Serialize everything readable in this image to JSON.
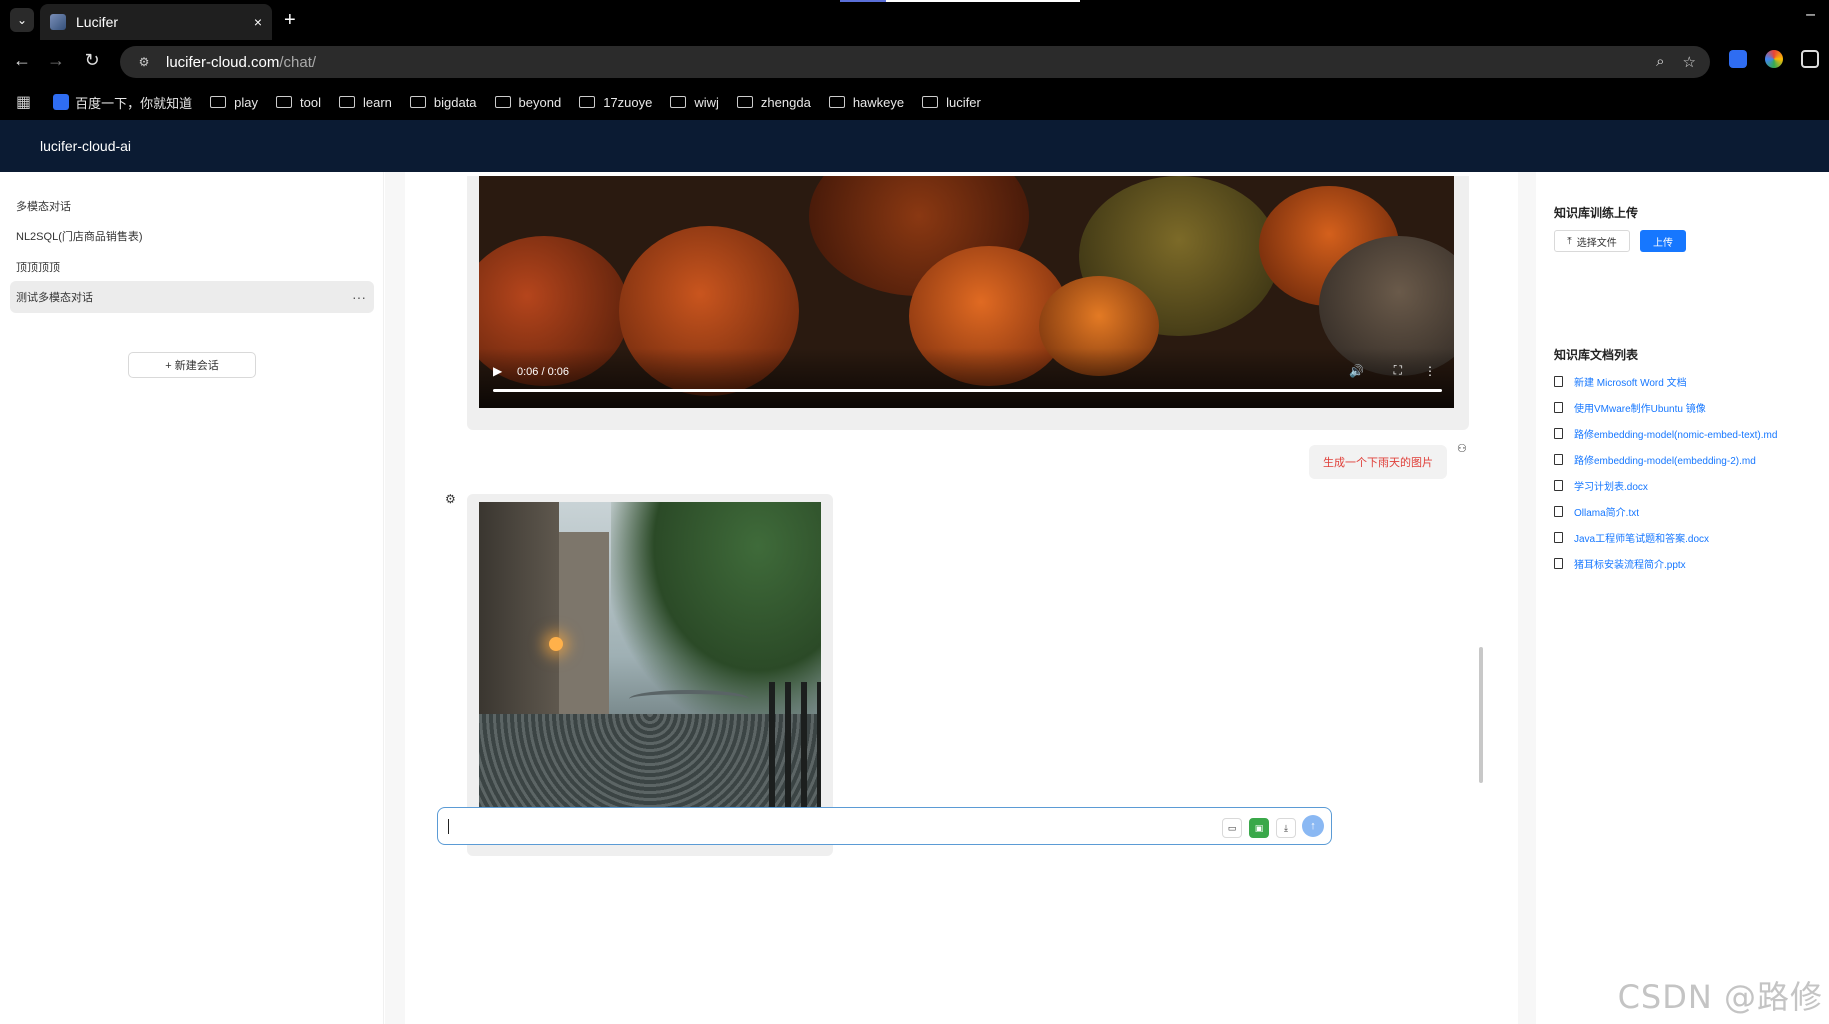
{
  "browser": {
    "tab_title": "Lucifer",
    "tab_close": "×",
    "new_tab": "+",
    "url_host": "lucifer-cloud.com",
    "url_path": "/chat/",
    "minimize": "–",
    "bookmarks": [
      "百度一下，你就知道",
      "play",
      "tool",
      "learn",
      "bigdata",
      "beyond",
      "17zuoye",
      "wiwj",
      "zhengda",
      "hawkeye",
      "lucifer"
    ]
  },
  "app": {
    "title": "lucifer-cloud-ai"
  },
  "sidebar": {
    "conversations": [
      {
        "label": "多模态对话"
      },
      {
        "label": "NL2SQL(门店商品销售表)"
      },
      {
        "label": "顶顶顶顶"
      },
      {
        "label": "测试多模态对话",
        "active": true,
        "more": "···"
      }
    ],
    "new_chat_label": "+ 新建会话"
  },
  "chat": {
    "video": {
      "time": "0:06 / 0:06",
      "progress": 1.0
    },
    "user_message": "生成一个下雨天的图片",
    "input_value": ""
  },
  "right_panel": {
    "upload_title": "知识库训练上传",
    "select_file_label": "选择文件",
    "upload_label": "上传",
    "doc_list_title": "知识库文档列表",
    "documents": [
      "新建 Microsoft Word 文档",
      "使用VMware制作Ubuntu 镜像",
      "路修embedding-model(nomic-embed-text).md",
      "路修embedding-model(embedding-2).md",
      "学习计划表.docx",
      "Ollama简介.txt",
      "Java工程师笔试题和答案.docx",
      "猪耳标安装流程简介.pptx"
    ]
  },
  "watermark": "CSDN @路修",
  "colors": {
    "accent": "#1677ff",
    "header": "#0b1b33",
    "user_msg_text": "#e0403a"
  }
}
